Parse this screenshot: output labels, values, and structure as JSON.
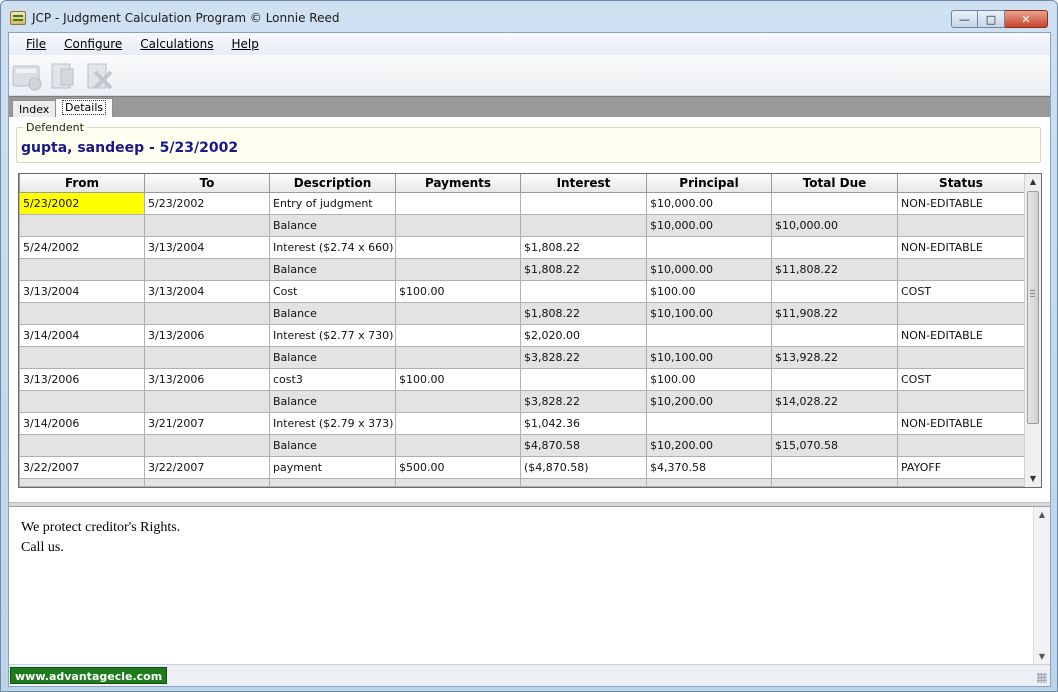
{
  "window": {
    "title": "JCP - Judgment Calculation Program © Lonnie Reed"
  },
  "menu": [
    "File",
    "Configure",
    "Calculations",
    "Help"
  ],
  "tabs": {
    "index": "Index",
    "details": "Details"
  },
  "defendant": {
    "label": "Defendent",
    "name": "gupta, sandeep - 5/23/2002"
  },
  "grid": {
    "headers": [
      "From",
      "To",
      "Description",
      "Payments",
      "Interest",
      "Principal",
      "Total Due",
      "Status"
    ],
    "rows": [
      [
        "5/23/2002",
        "5/23/2002",
        "Entry of judgment",
        "",
        "",
        "$10,000.00",
        "",
        "NON-EDITABLE"
      ],
      [
        "",
        "",
        "Balance",
        "",
        "",
        "$10,000.00",
        "$10,000.00",
        ""
      ],
      [
        "5/24/2002",
        "3/13/2004",
        "Interest ($2.74 x 660)",
        "",
        "$1,808.22",
        "",
        "",
        "NON-EDITABLE"
      ],
      [
        "",
        "",
        "Balance",
        "",
        "$1,808.22",
        "$10,000.00",
        "$11,808.22",
        ""
      ],
      [
        "3/13/2004",
        "3/13/2004",
        "Cost",
        "$100.00",
        "",
        "$100.00",
        "",
        "COST"
      ],
      [
        "",
        "",
        "Balance",
        "",
        "$1,808.22",
        "$10,100.00",
        "$11,908.22",
        ""
      ],
      [
        "3/14/2004",
        "3/13/2006",
        "Interest ($2.77 x 730)",
        "",
        "$2,020.00",
        "",
        "",
        "NON-EDITABLE"
      ],
      [
        "",
        "",
        "Balance",
        "",
        "$3,828.22",
        "$10,100.00",
        "$13,928.22",
        ""
      ],
      [
        "3/13/2006",
        "3/13/2006",
        "cost3",
        "$100.00",
        "",
        "$100.00",
        "",
        "COST"
      ],
      [
        "",
        "",
        "Balance",
        "",
        "$3,828.22",
        "$10,200.00",
        "$14,028.22",
        ""
      ],
      [
        "3/14/2006",
        "3/21/2007",
        "Interest ($2.79 x 373)",
        "",
        "$1,042.36",
        "",
        "",
        "NON-EDITABLE"
      ],
      [
        "",
        "",
        "Balance",
        "",
        "$4,870.58",
        "$10,200.00",
        "$15,070.58",
        ""
      ],
      [
        "3/22/2007",
        "3/22/2007",
        "payment",
        "$500.00",
        "($4,870.58)",
        "$4,370.58",
        "",
        "PAYOFF"
      ]
    ]
  },
  "message": {
    "line1": "We protect creditor's Rights.",
    "line2": "Call us."
  },
  "status": {
    "website": "www.advantagecle.com"
  },
  "colors": {
    "selected_cell": "#ffff00",
    "defendant_name": "#18188a",
    "website_bg": "#1d7a1d"
  }
}
